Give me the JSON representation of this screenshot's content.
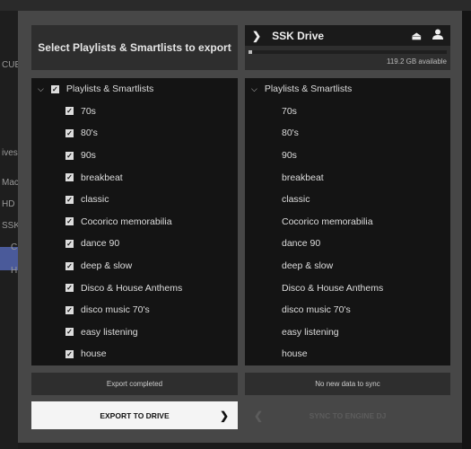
{
  "background": {
    "left_items": [
      "CUE",
      "ives",
      "Mac",
      "HD",
      "SSK",
      "C",
      "H"
    ]
  },
  "header": {
    "title": "Select Playlists & Smartlists to export"
  },
  "drive": {
    "name": "SSK Drive",
    "available": "119.2 GB available",
    "used_fraction": 0.005
  },
  "left_list": {
    "root": "Playlists & Smartlists",
    "root_checked": true,
    "items": [
      "70s",
      "80's",
      "90s",
      "breakbeat",
      "classic",
      "Cocorico memorabilia",
      "dance 90",
      "deep & slow",
      "Disco & House Anthems",
      "disco music 70's",
      "easy listening",
      "house"
    ]
  },
  "right_list": {
    "root": "Playlists & Smartlists",
    "items": [
      "70s",
      "80's",
      "90s",
      "breakbeat",
      "classic",
      "Cocorico memorabilia",
      "dance 90",
      "deep & slow",
      "Disco & House Anthems",
      "disco music 70's",
      "easy listening",
      "house"
    ]
  },
  "status": {
    "left": "Export completed",
    "right": "No new data to sync"
  },
  "buttons": {
    "export": "EXPORT TO DRIVE",
    "sync": "SYNC TO ENGINE DJ"
  }
}
